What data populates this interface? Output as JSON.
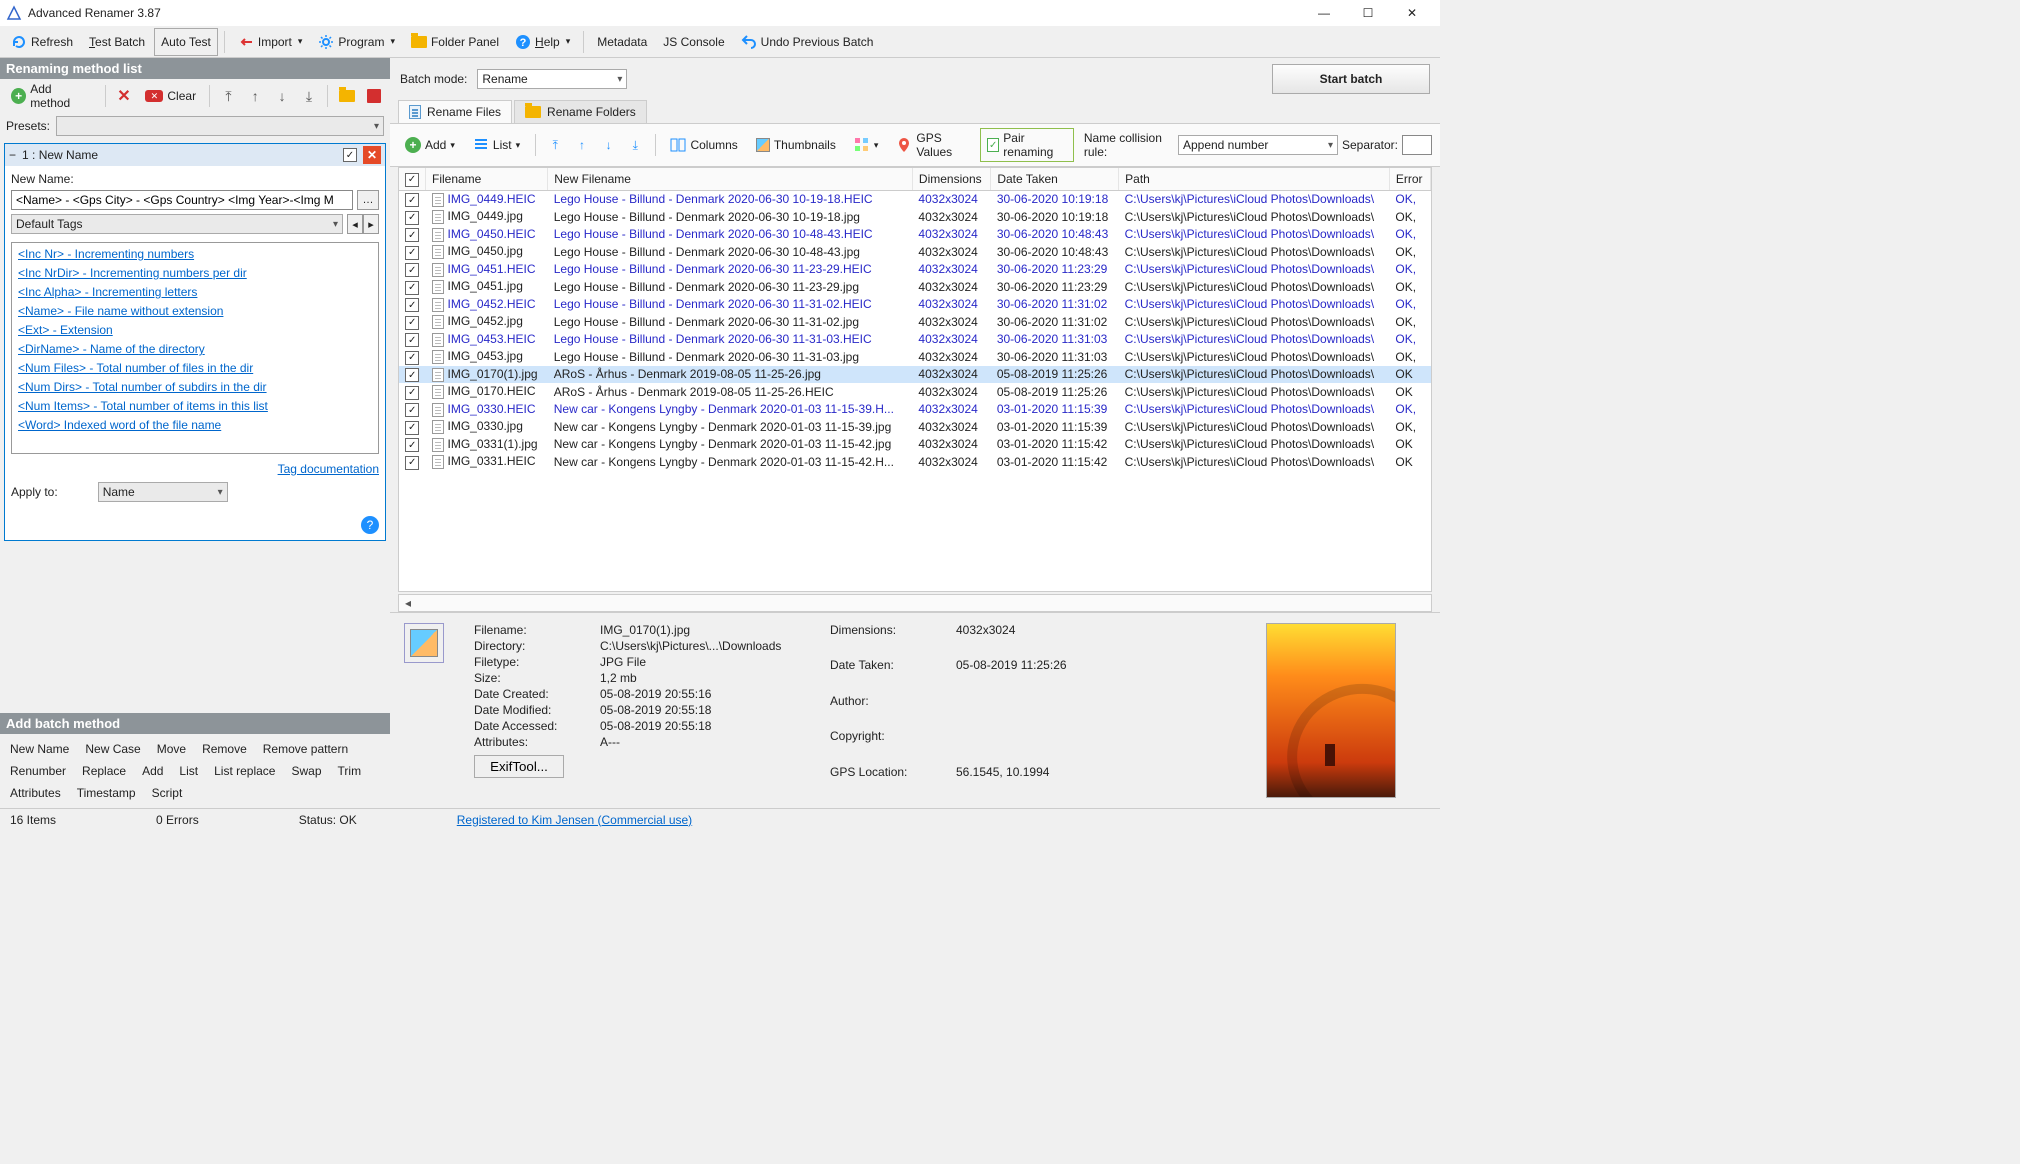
{
  "title": "Advanced Renamer 3.87",
  "toolbar": {
    "refresh": "Refresh",
    "testbatch": "Test Batch",
    "autotest": "Auto Test",
    "import": "Import",
    "program": "Program",
    "folderpanel": "Folder Panel",
    "help": "Help",
    "metadata": "Metadata",
    "jsconsole": "JS Console",
    "undo": "Undo Previous Batch"
  },
  "left": {
    "panel1": "Renaming method list",
    "addmethod": "Add method",
    "clear": "Clear",
    "presets_label": "Presets:",
    "method_title": "1 : New Name",
    "newname_label": "New Name:",
    "newname_value": "<Name> - <Gps City> - <Gps Country> <Img Year>-<Img M",
    "default_tags": "Default Tags",
    "tags": [
      "<Inc Nr> - Incrementing numbers",
      "<Inc NrDir> - Incrementing numbers per dir",
      "<Inc Alpha> - Incrementing letters",
      "<Name> - File name without extension",
      "<Ext> - Extension",
      "<DirName> - Name of the directory",
      "<Num Files> - Total number of files in the dir",
      "<Num Dirs> - Total number of subdirs in the dir",
      "<Num Items> - Total number of items in this list",
      "<Word> Indexed word of the file name"
    ],
    "tag_doc": "Tag documentation",
    "apply_to": "Apply to:",
    "apply_to_val": "Name",
    "panel2": "Add batch method",
    "batch_methods": [
      "New Name",
      "New Case",
      "Move",
      "Remove",
      "Remove pattern",
      "Renumber",
      "Replace",
      "Add",
      "List",
      "List replace",
      "Swap",
      "Trim",
      "Attributes",
      "Timestamp",
      "Script"
    ]
  },
  "right": {
    "batchmode_label": "Batch mode:",
    "batchmode_val": "Rename",
    "startbatch": "Start batch",
    "tab_files": "Rename Files",
    "tab_folders": "Rename Folders",
    "ftb": {
      "add": "Add",
      "list": "List",
      "columns": "Columns",
      "thumbs": "Thumbnails",
      "gps": "GPS Values",
      "pair": "Pair renaming",
      "collision": "Name collision rule:",
      "collision_val": "Append number",
      "sep": "Separator:"
    },
    "columns": [
      "Filename",
      "New Filename",
      "Dimensions",
      "Date Taken",
      "Path",
      "Error"
    ],
    "rows": [
      {
        "heic": true,
        "fn": "IMG_0449.HEIC",
        "nf": "Lego House - Billund - Denmark 2020-06-30 10-19-18.HEIC",
        "dim": "4032x3024",
        "dt": "30-06-2020 10:19:18",
        "path": "C:\\Users\\kj\\Pictures\\iCloud Photos\\Downloads\\",
        "err": "OK,"
      },
      {
        "heic": false,
        "fn": "IMG_0449.jpg",
        "nf": "Lego House - Billund - Denmark 2020-06-30 10-19-18.jpg",
        "dim": "4032x3024",
        "dt": "30-06-2020 10:19:18",
        "path": "C:\\Users\\kj\\Pictures\\iCloud Photos\\Downloads\\",
        "err": "OK,"
      },
      {
        "heic": true,
        "fn": "IMG_0450.HEIC",
        "nf": "Lego House - Billund - Denmark 2020-06-30 10-48-43.HEIC",
        "dim": "4032x3024",
        "dt": "30-06-2020 10:48:43",
        "path": "C:\\Users\\kj\\Pictures\\iCloud Photos\\Downloads\\",
        "err": "OK,"
      },
      {
        "heic": false,
        "fn": "IMG_0450.jpg",
        "nf": "Lego House - Billund - Denmark 2020-06-30 10-48-43.jpg",
        "dim": "4032x3024",
        "dt": "30-06-2020 10:48:43",
        "path": "C:\\Users\\kj\\Pictures\\iCloud Photos\\Downloads\\",
        "err": "OK,"
      },
      {
        "heic": true,
        "fn": "IMG_0451.HEIC",
        "nf": "Lego House - Billund - Denmark 2020-06-30 11-23-29.HEIC",
        "dim": "4032x3024",
        "dt": "30-06-2020 11:23:29",
        "path": "C:\\Users\\kj\\Pictures\\iCloud Photos\\Downloads\\",
        "err": "OK,"
      },
      {
        "heic": false,
        "fn": "IMG_0451.jpg",
        "nf": "Lego House - Billund - Denmark 2020-06-30 11-23-29.jpg",
        "dim": "4032x3024",
        "dt": "30-06-2020 11:23:29",
        "path": "C:\\Users\\kj\\Pictures\\iCloud Photos\\Downloads\\",
        "err": "OK,"
      },
      {
        "heic": true,
        "fn": "IMG_0452.HEIC",
        "nf": "Lego House - Billund - Denmark 2020-06-30 11-31-02.HEIC",
        "dim": "4032x3024",
        "dt": "30-06-2020 11:31:02",
        "path": "C:\\Users\\kj\\Pictures\\iCloud Photos\\Downloads\\",
        "err": "OK,"
      },
      {
        "heic": false,
        "fn": "IMG_0452.jpg",
        "nf": "Lego House - Billund - Denmark 2020-06-30 11-31-02.jpg",
        "dim": "4032x3024",
        "dt": "30-06-2020 11:31:02",
        "path": "C:\\Users\\kj\\Pictures\\iCloud Photos\\Downloads\\",
        "err": "OK,"
      },
      {
        "heic": true,
        "fn": "IMG_0453.HEIC",
        "nf": "Lego House - Billund - Denmark 2020-06-30 11-31-03.HEIC",
        "dim": "4032x3024",
        "dt": "30-06-2020 11:31:03",
        "path": "C:\\Users\\kj\\Pictures\\iCloud Photos\\Downloads\\",
        "err": "OK,"
      },
      {
        "heic": false,
        "fn": "IMG_0453.jpg",
        "nf": "Lego House - Billund - Denmark 2020-06-30 11-31-03.jpg",
        "dim": "4032x3024",
        "dt": "30-06-2020 11:31:03",
        "path": "C:\\Users\\kj\\Pictures\\iCloud Photos\\Downloads\\",
        "err": "OK,"
      },
      {
        "heic": false,
        "sel": true,
        "fn": "IMG_0170(1).jpg",
        "nf": "ARoS - Århus - Denmark 2019-08-05 11-25-26.jpg",
        "dim": "4032x3024",
        "dt": "05-08-2019 11:25:26",
        "path": "C:\\Users\\kj\\Pictures\\iCloud Photos\\Downloads\\",
        "err": "OK"
      },
      {
        "heic": false,
        "fn": "IMG_0170.HEIC",
        "nf": "ARoS - Århus - Denmark 2019-08-05 11-25-26.HEIC",
        "dim": "4032x3024",
        "dt": "05-08-2019 11:25:26",
        "path": "C:\\Users\\kj\\Pictures\\iCloud Photos\\Downloads\\",
        "err": "OK"
      },
      {
        "heic": true,
        "fn": "IMG_0330.HEIC",
        "nf": "New car - Kongens Lyngby - Denmark 2020-01-03 11-15-39.H...",
        "dim": "4032x3024",
        "dt": "03-01-2020 11:15:39",
        "path": "C:\\Users\\kj\\Pictures\\iCloud Photos\\Downloads\\",
        "err": "OK,"
      },
      {
        "heic": false,
        "fn": "IMG_0330.jpg",
        "nf": "New car - Kongens Lyngby - Denmark 2020-01-03 11-15-39.jpg",
        "dim": "4032x3024",
        "dt": "03-01-2020 11:15:39",
        "path": "C:\\Users\\kj\\Pictures\\iCloud Photos\\Downloads\\",
        "err": "OK,"
      },
      {
        "heic": false,
        "fn": "IMG_0331(1).jpg",
        "nf": "New car - Kongens Lyngby - Denmark 2020-01-03 11-15-42.jpg",
        "dim": "4032x3024",
        "dt": "03-01-2020 11:15:42",
        "path": "C:\\Users\\kj\\Pictures\\iCloud Photos\\Downloads\\",
        "err": "OK"
      },
      {
        "heic": false,
        "fn": "IMG_0331.HEIC",
        "nf": "New car - Kongens Lyngby - Denmark 2020-01-03 11-15-42.H...",
        "dim": "4032x3024",
        "dt": "03-01-2020 11:15:42",
        "path": "C:\\Users\\kj\\Pictures\\iCloud Photos\\Downloads\\",
        "err": "OK"
      }
    ],
    "details": {
      "labels": {
        "filename": "Filename:",
        "directory": "Directory:",
        "filetype": "Filetype:",
        "size": "Size:",
        "created": "Date Created:",
        "modified": "Date Modified:",
        "accessed": "Date Accessed:",
        "attrs": "Attributes:",
        "dimensions": "Dimensions:",
        "taken": "Date Taken:",
        "author": "Author:",
        "copyright": "Copyright:",
        "gps": "GPS Location:"
      },
      "values": {
        "filename": "IMG_0170(1).jpg",
        "directory": "C:\\Users\\kj\\Pictures\\...\\Downloads",
        "filetype": "JPG File",
        "size": "1,2 mb",
        "created": "05-08-2019 20:55:16",
        "modified": "05-08-2019 20:55:18",
        "accessed": "05-08-2019 20:55:18",
        "attrs": "A---",
        "dimensions": "4032x3024",
        "taken": "05-08-2019 11:25:26",
        "author": "",
        "copyright": "",
        "gps": "56.1545, 10.1994"
      },
      "exif_btn": "ExifTool..."
    }
  },
  "status": {
    "items": "16 Items",
    "errors": "0 Errors",
    "status": "Status: OK",
    "reg": "Registered to Kim Jensen (Commercial use)"
  }
}
